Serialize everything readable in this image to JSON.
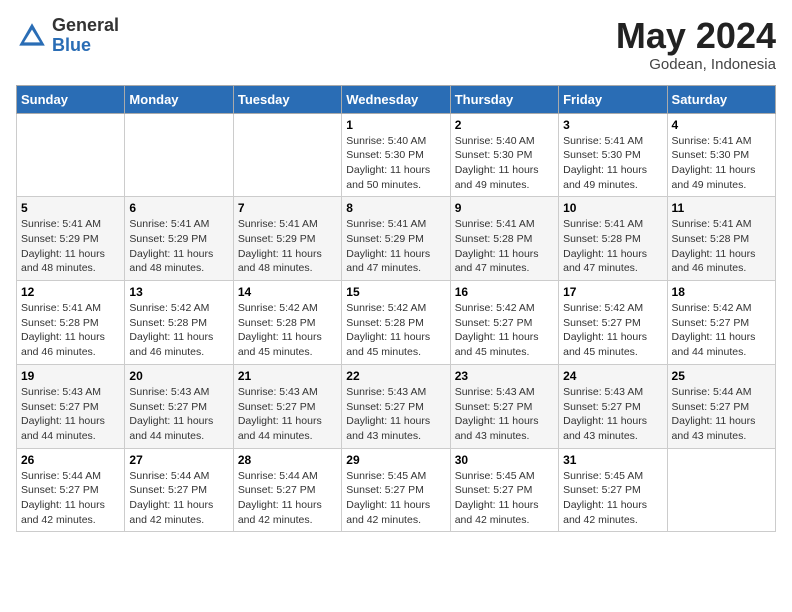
{
  "header": {
    "logo_general": "General",
    "logo_blue": "Blue",
    "month_title": "May 2024",
    "location": "Godean, Indonesia"
  },
  "calendar": {
    "days_of_week": [
      "Sunday",
      "Monday",
      "Tuesday",
      "Wednesday",
      "Thursday",
      "Friday",
      "Saturday"
    ],
    "weeks": [
      [
        {
          "day": "",
          "info": ""
        },
        {
          "day": "",
          "info": ""
        },
        {
          "day": "",
          "info": ""
        },
        {
          "day": "1",
          "info": "Sunrise: 5:40 AM\nSunset: 5:30 PM\nDaylight: 11 hours\nand 50 minutes."
        },
        {
          "day": "2",
          "info": "Sunrise: 5:40 AM\nSunset: 5:30 PM\nDaylight: 11 hours\nand 49 minutes."
        },
        {
          "day": "3",
          "info": "Sunrise: 5:41 AM\nSunset: 5:30 PM\nDaylight: 11 hours\nand 49 minutes."
        },
        {
          "day": "4",
          "info": "Sunrise: 5:41 AM\nSunset: 5:30 PM\nDaylight: 11 hours\nand 49 minutes."
        }
      ],
      [
        {
          "day": "5",
          "info": "Sunrise: 5:41 AM\nSunset: 5:29 PM\nDaylight: 11 hours\nand 48 minutes."
        },
        {
          "day": "6",
          "info": "Sunrise: 5:41 AM\nSunset: 5:29 PM\nDaylight: 11 hours\nand 48 minutes."
        },
        {
          "day": "7",
          "info": "Sunrise: 5:41 AM\nSunset: 5:29 PM\nDaylight: 11 hours\nand 48 minutes."
        },
        {
          "day": "8",
          "info": "Sunrise: 5:41 AM\nSunset: 5:29 PM\nDaylight: 11 hours\nand 47 minutes."
        },
        {
          "day": "9",
          "info": "Sunrise: 5:41 AM\nSunset: 5:28 PM\nDaylight: 11 hours\nand 47 minutes."
        },
        {
          "day": "10",
          "info": "Sunrise: 5:41 AM\nSunset: 5:28 PM\nDaylight: 11 hours\nand 47 minutes."
        },
        {
          "day": "11",
          "info": "Sunrise: 5:41 AM\nSunset: 5:28 PM\nDaylight: 11 hours\nand 46 minutes."
        }
      ],
      [
        {
          "day": "12",
          "info": "Sunrise: 5:41 AM\nSunset: 5:28 PM\nDaylight: 11 hours\nand 46 minutes."
        },
        {
          "day": "13",
          "info": "Sunrise: 5:42 AM\nSunset: 5:28 PM\nDaylight: 11 hours\nand 46 minutes."
        },
        {
          "day": "14",
          "info": "Sunrise: 5:42 AM\nSunset: 5:28 PM\nDaylight: 11 hours\nand 45 minutes."
        },
        {
          "day": "15",
          "info": "Sunrise: 5:42 AM\nSunset: 5:28 PM\nDaylight: 11 hours\nand 45 minutes."
        },
        {
          "day": "16",
          "info": "Sunrise: 5:42 AM\nSunset: 5:27 PM\nDaylight: 11 hours\nand 45 minutes."
        },
        {
          "day": "17",
          "info": "Sunrise: 5:42 AM\nSunset: 5:27 PM\nDaylight: 11 hours\nand 45 minutes."
        },
        {
          "day": "18",
          "info": "Sunrise: 5:42 AM\nSunset: 5:27 PM\nDaylight: 11 hours\nand 44 minutes."
        }
      ],
      [
        {
          "day": "19",
          "info": "Sunrise: 5:43 AM\nSunset: 5:27 PM\nDaylight: 11 hours\nand 44 minutes."
        },
        {
          "day": "20",
          "info": "Sunrise: 5:43 AM\nSunset: 5:27 PM\nDaylight: 11 hours\nand 44 minutes."
        },
        {
          "day": "21",
          "info": "Sunrise: 5:43 AM\nSunset: 5:27 PM\nDaylight: 11 hours\nand 44 minutes."
        },
        {
          "day": "22",
          "info": "Sunrise: 5:43 AM\nSunset: 5:27 PM\nDaylight: 11 hours\nand 43 minutes."
        },
        {
          "day": "23",
          "info": "Sunrise: 5:43 AM\nSunset: 5:27 PM\nDaylight: 11 hours\nand 43 minutes."
        },
        {
          "day": "24",
          "info": "Sunrise: 5:43 AM\nSunset: 5:27 PM\nDaylight: 11 hours\nand 43 minutes."
        },
        {
          "day": "25",
          "info": "Sunrise: 5:44 AM\nSunset: 5:27 PM\nDaylight: 11 hours\nand 43 minutes."
        }
      ],
      [
        {
          "day": "26",
          "info": "Sunrise: 5:44 AM\nSunset: 5:27 PM\nDaylight: 11 hours\nand 42 minutes."
        },
        {
          "day": "27",
          "info": "Sunrise: 5:44 AM\nSunset: 5:27 PM\nDaylight: 11 hours\nand 42 minutes."
        },
        {
          "day": "28",
          "info": "Sunrise: 5:44 AM\nSunset: 5:27 PM\nDaylight: 11 hours\nand 42 minutes."
        },
        {
          "day": "29",
          "info": "Sunrise: 5:45 AM\nSunset: 5:27 PM\nDaylight: 11 hours\nand 42 minutes."
        },
        {
          "day": "30",
          "info": "Sunrise: 5:45 AM\nSunset: 5:27 PM\nDaylight: 11 hours\nand 42 minutes."
        },
        {
          "day": "31",
          "info": "Sunrise: 5:45 AM\nSunset: 5:27 PM\nDaylight: 11 hours\nand 42 minutes."
        },
        {
          "day": "",
          "info": ""
        }
      ]
    ]
  }
}
